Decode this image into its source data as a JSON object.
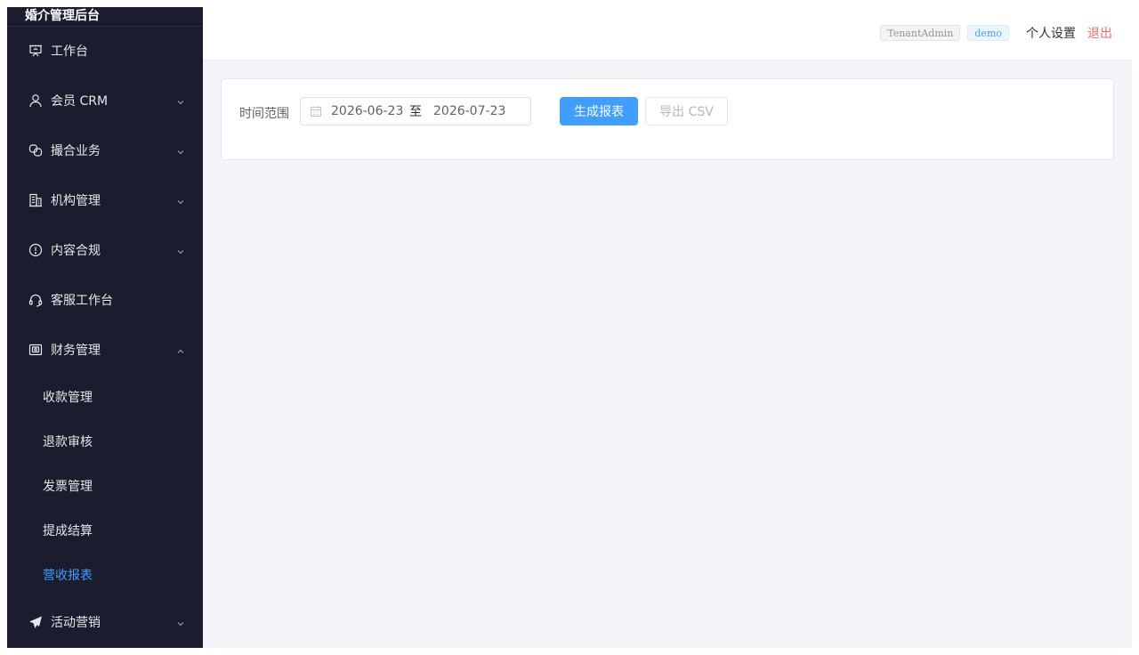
{
  "app": {
    "title": "婚介管理后台"
  },
  "sidebar": {
    "items": [
      {
        "label": "工作台",
        "icon": "monitor-icon",
        "has_arrow": false
      },
      {
        "label": "会员 CRM",
        "icon": "user-icon",
        "has_arrow": true,
        "expanded": false
      },
      {
        "label": "撮合业务",
        "icon": "link-icon",
        "has_arrow": true,
        "expanded": false
      },
      {
        "label": "机构管理",
        "icon": "building-icon",
        "has_arrow": true,
        "expanded": false
      },
      {
        "label": "内容合规",
        "icon": "warning-icon",
        "has_arrow": true,
        "expanded": false
      },
      {
        "label": "客服工作台",
        "icon": "headset-icon",
        "has_arrow": false
      },
      {
        "label": "财务管理",
        "icon": "wallet-icon",
        "has_arrow": true,
        "expanded": true
      },
      {
        "label": "活动营销",
        "icon": "send-icon",
        "has_arrow": true,
        "expanded": false
      }
    ],
    "finance_children": [
      {
        "label": "收款管理",
        "active": false
      },
      {
        "label": "退款审核",
        "active": false
      },
      {
        "label": "发票管理",
        "active": false
      },
      {
        "label": "提成结算",
        "active": false
      },
      {
        "label": "营收报表",
        "active": true
      }
    ]
  },
  "header": {
    "role_tag": "TenantAdmin",
    "tenant_tag": "demo",
    "settings_label": "个人设置",
    "logout_label": "退出"
  },
  "report": {
    "range_label": "时间范围",
    "start_date": "2026-06-23",
    "range_separator": "至",
    "end_date": "2026-07-23",
    "generate_button": "生成报表",
    "export_button": "导出 CSV"
  },
  "colors": {
    "sidebar_bg": "#1b1c2e",
    "accent": "#409eff",
    "danger": "#f56c6c",
    "content_bg": "#f4f5f9"
  }
}
